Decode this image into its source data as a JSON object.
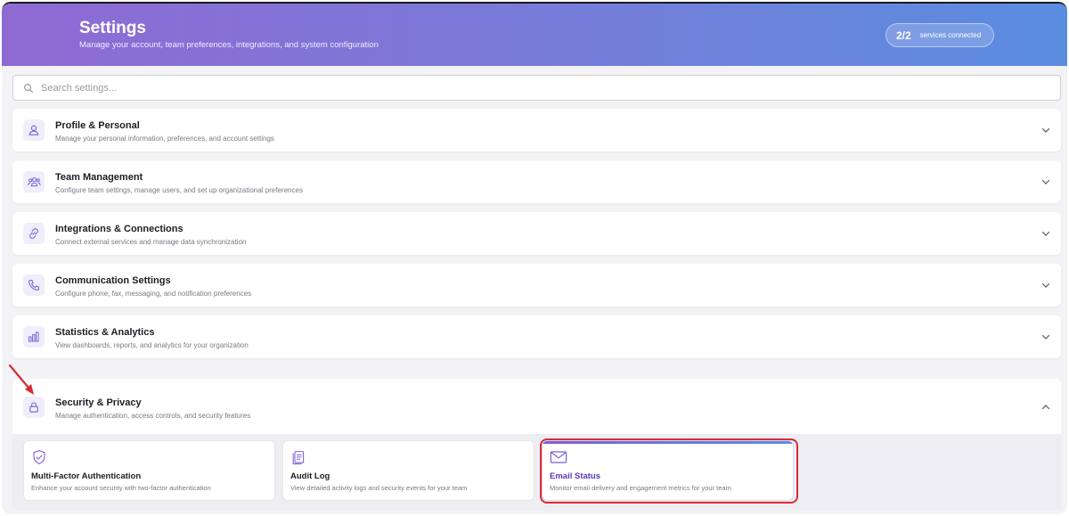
{
  "header": {
    "title": "Settings",
    "subtitle": "Manage your account, team preferences, integrations, and system configuration",
    "services_count": "2/2",
    "services_label": "services connected"
  },
  "search": {
    "placeholder": "Search settings...",
    "value": ""
  },
  "sections": [
    {
      "icon": "user-icon",
      "title": "Profile & Personal",
      "description": "Manage your personal information, preferences, and account settings",
      "expanded": false
    },
    {
      "icon": "team-icon",
      "title": "Team Management",
      "description": "Configure team settings, manage users, and set up organizational preferences",
      "expanded": false
    },
    {
      "icon": "link-icon",
      "title": "Integrations & Connections",
      "description": "Connect external services and manage data synchronization",
      "expanded": false
    },
    {
      "icon": "phone-icon",
      "title": "Communication Settings",
      "description": "Configure phone, fax, messaging, and notification preferences",
      "expanded": false
    },
    {
      "icon": "bar-chart-icon",
      "title": "Statistics & Analytics",
      "description": "View dashboards, reports, and analytics for your organization",
      "expanded": false
    },
    {
      "icon": "lock-icon",
      "title": "Security & Privacy",
      "description": "Manage authentication, access controls, and security features",
      "expanded": true
    }
  ],
  "security_cards": [
    {
      "icon": "shield-check-icon",
      "title": "Multi-Factor Authentication",
      "description": "Enhance your account security with two-factor authentication",
      "active": false
    },
    {
      "icon": "clipboard-icon",
      "title": "Audit Log",
      "description": "View detailed activity logs and security events for your team",
      "active": false
    },
    {
      "icon": "mail-icon",
      "title": "Email Status",
      "description": "Monitor email delivery and engagement metrics for your team",
      "active": true
    }
  ],
  "colors": {
    "header_gradient_start": "#8f6ad3",
    "header_gradient_end": "#5a8de0",
    "accent": "#7c5fd6",
    "highlight_annotation": "#d82b35"
  }
}
